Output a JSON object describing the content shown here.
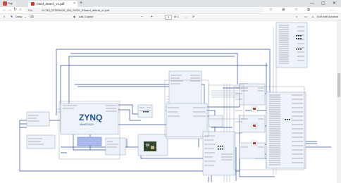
{
  "browser": {
    "first_tab": {
      "label": "Digi Sh"
    },
    "active_tab": {
      "label": "hand_detect_v1.pdf",
      "close": "×"
    },
    "new_tab": "+",
    "window_controls": {
      "minimize": "—",
      "maximize": "▢",
      "close": "✕"
    },
    "nav": {
      "back": "←",
      "forward": "→",
      "refresh": "↻",
      "home": "⌂"
    },
    "url_prefix": "File",
    "url": "G:/THI_STORAGE_ON_SVSS_R/hand_detect_v1.pdf",
    "right_icons": [
      "☆",
      "⊞",
      "☆",
      "⧉",
      "…"
    ]
  },
  "pdf_toolbar": {
    "contents_icon": "≡",
    "draw_label": "Draw",
    "draw_chevron": "⌄",
    "erase_icon": "⌫",
    "ask_copilot_label": "Ask Copilot",
    "zoom_out": "−",
    "zoom_in": "+",
    "page_current": "1",
    "page_total": "of 1",
    "edit_label": "Edit with Acrobat",
    "search_icon": "⌕",
    "save_icon": "▭"
  },
  "diagram": {
    "zynq_label": "ZYNQ",
    "zynq_sub": "UltraSCALE+"
  },
  "colors": {
    "tabbar": "#dfe3e8",
    "wire": "#1f3f8f",
    "block_fill": "#e9f0f8",
    "block_border": "#8aa0bd",
    "zynq_text": "#1d4f91",
    "selected_block": "#a9b9ec"
  }
}
